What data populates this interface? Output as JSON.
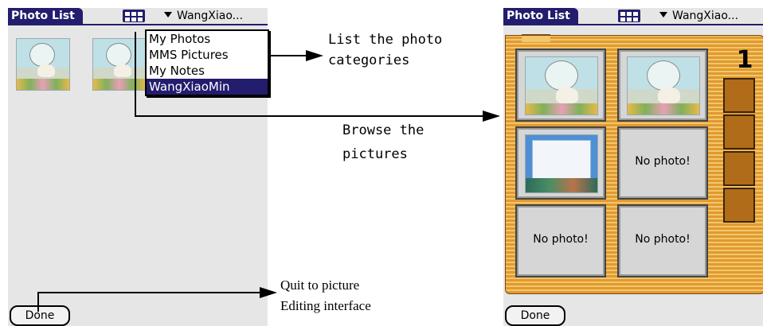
{
  "left_screen": {
    "title": "Photo List",
    "category_selector": "WangXiao...",
    "menu_items": [
      "My Photos",
      "MMS Pictures",
      "My Notes",
      "WangXiaoMin"
    ],
    "selected_menu_item": "WangXiaoMin",
    "done_label": "Done"
  },
  "right_screen": {
    "title": "Photo List",
    "category_selector": "WangXiao...",
    "page_number": "1",
    "cells": [
      "",
      "",
      "",
      "No photo!",
      "No photo!",
      "No photo!"
    ],
    "done_label": "Done"
  },
  "annotations": {
    "list_categories": [
      "List the photo",
      "categories"
    ],
    "browse": [
      "Browse the",
      "pictures"
    ],
    "quit": [
      "Quit to picture",
      "Editing interface"
    ]
  },
  "colors": {
    "titlebar": "#231d6e",
    "frame": "#e09a30",
    "tab": "#b06c18"
  }
}
